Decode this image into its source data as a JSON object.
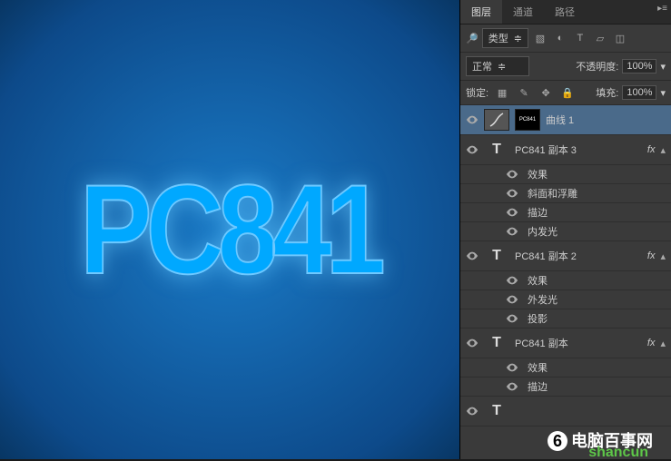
{
  "canvas": {
    "text": "PC841"
  },
  "panel": {
    "tabs": [
      "图层",
      "通道",
      "路径"
    ],
    "activeTab": 0,
    "filter": {
      "label": "类型",
      "search_glyph": "🔎"
    },
    "blend": {
      "mode": "正常",
      "opacity_label": "不透明度:",
      "opacity": "100%"
    },
    "lock": {
      "label": "锁定:",
      "fill_label": "填充:",
      "fill": "100%"
    },
    "layers": [
      {
        "type": "adjustment",
        "name": "曲线 1",
        "selected": true,
        "hasMask": true
      },
      {
        "type": "text",
        "name": "PC841 副本 3",
        "fx": true,
        "effects": [
          "效果",
          "斜面和浮雕",
          "描边",
          "内发光"
        ]
      },
      {
        "type": "text",
        "name": "PC841 副本 2",
        "fx": true,
        "effects": [
          "效果",
          "外发光",
          "投影"
        ]
      },
      {
        "type": "text",
        "name": "PC841 副本",
        "fx": true,
        "effects": [
          "效果",
          "描边"
        ]
      },
      {
        "type": "text",
        "name": "",
        "fx": true,
        "partial": true
      }
    ]
  },
  "watermark": {
    "main": "电脑百事网",
    "sub": "shancun"
  }
}
